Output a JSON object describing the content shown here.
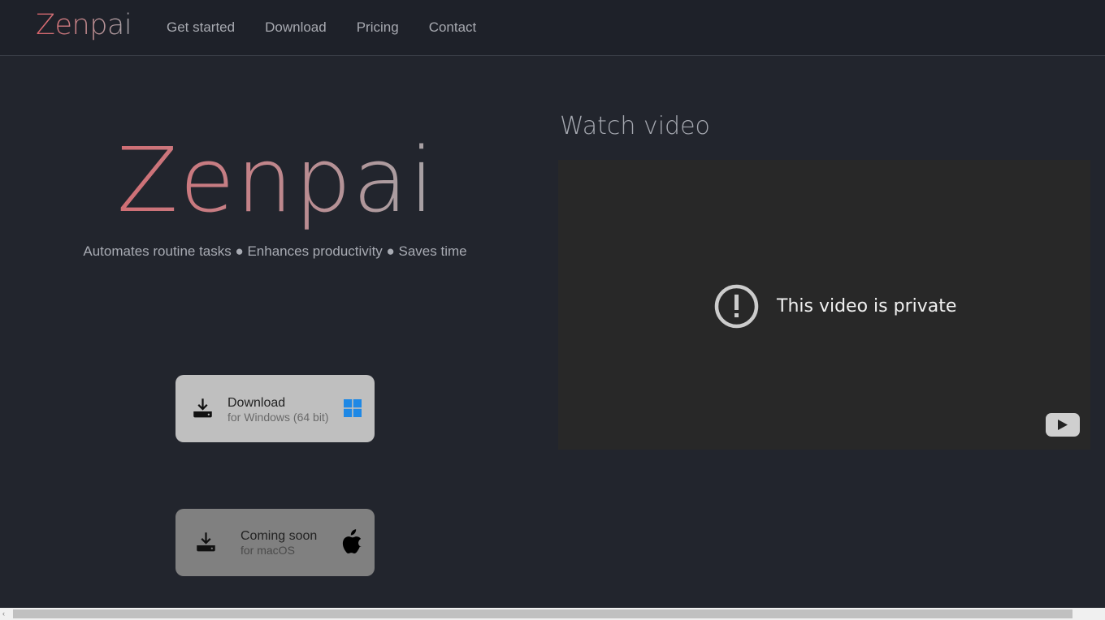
{
  "navbar": {
    "brand": "Zenpai",
    "links": [
      {
        "label": "Get started"
      },
      {
        "label": "Download"
      },
      {
        "label": "Pricing"
      },
      {
        "label": "Contact"
      }
    ]
  },
  "hero": {
    "title": "Zenpai",
    "tagline": "Automates routine tasks ● Enhances productivity ● Saves time",
    "gradient_colors": [
      "#db5c62",
      "#a2a2a6"
    ]
  },
  "downloads": {
    "windows": {
      "label": "Download",
      "sublabel": "for Windows (64 bit)",
      "icon": "download-icon",
      "os_icon": "windows-logo-icon",
      "os_color": "#1e88e5"
    },
    "mac": {
      "label": "Coming soon",
      "sublabel": "for macOS",
      "icon": "download-icon",
      "os_icon": "apple-logo-icon"
    }
  },
  "video_section": {
    "title": "Watch video",
    "message": "This video is private",
    "message_icon": "alert-circle-icon",
    "player_button": "youtube-play-icon"
  }
}
